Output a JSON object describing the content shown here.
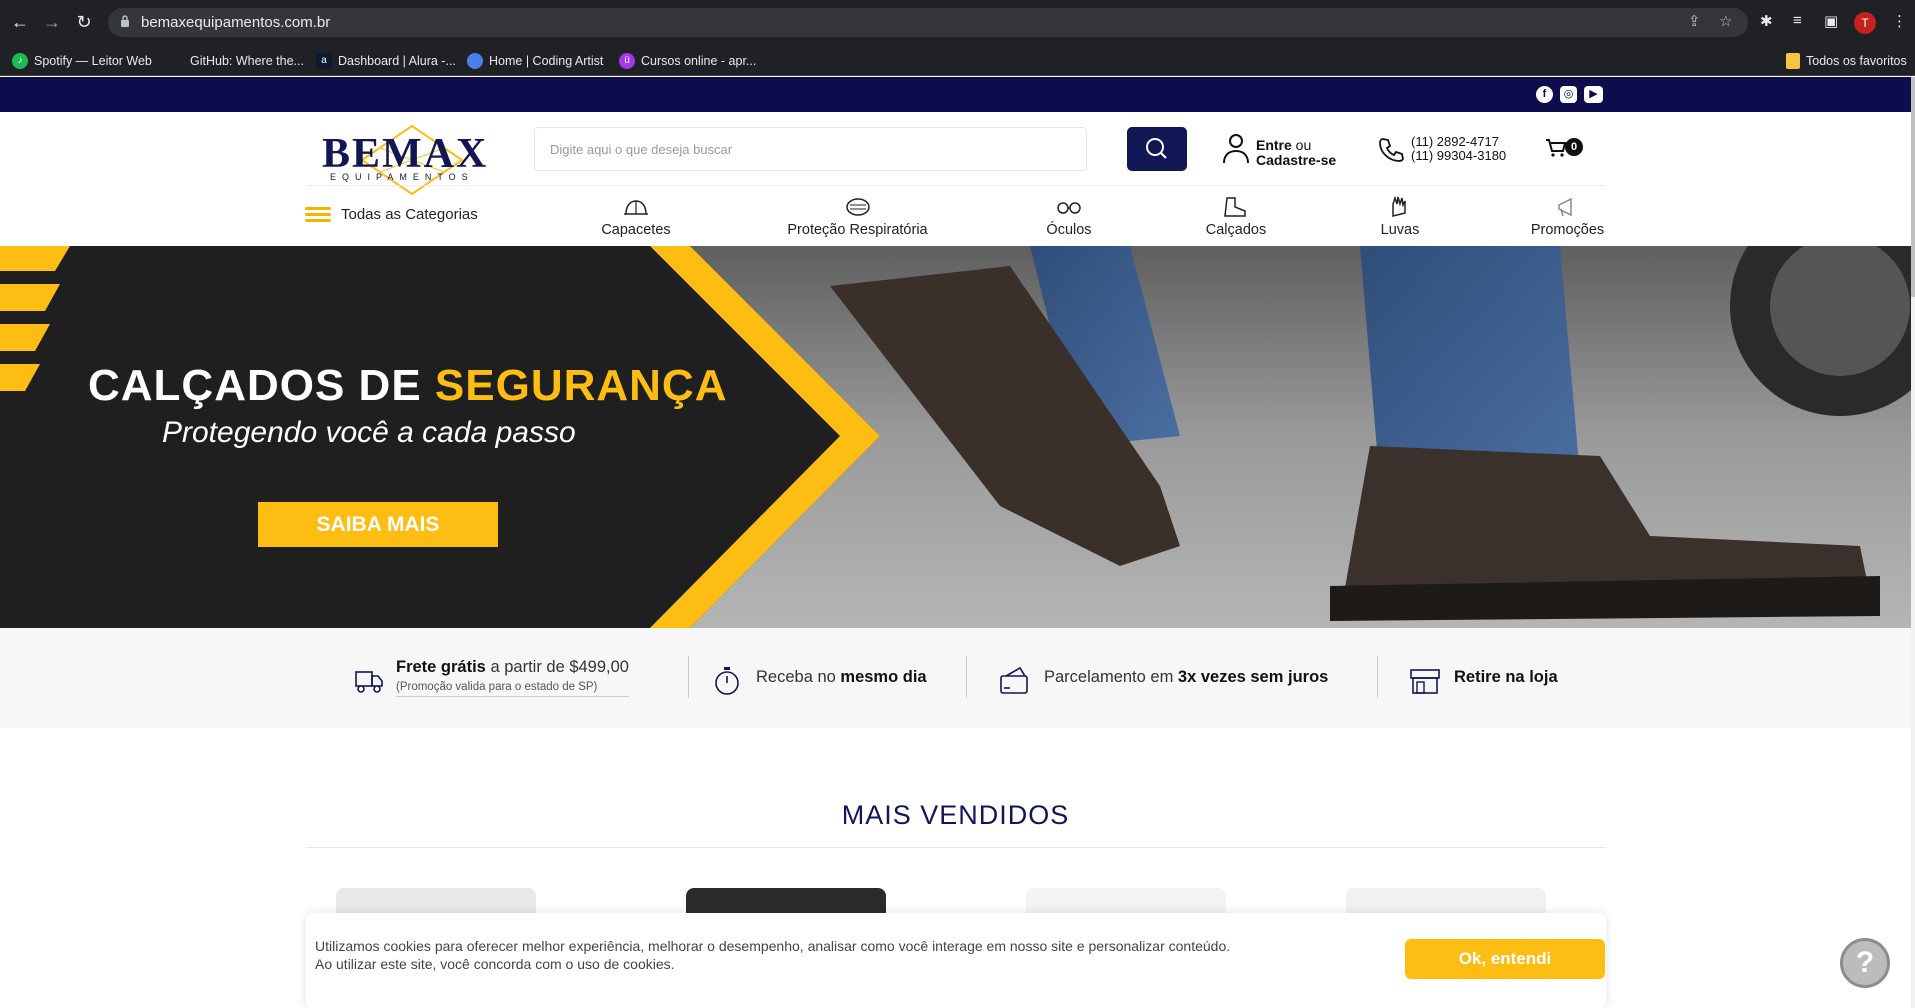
{
  "browser": {
    "url": "bemaxequipamentos.com.br",
    "bookmarks": [
      {
        "label": "Spotify — Leitor Web",
        "icon": "spotify-icon"
      },
      {
        "label": "GitHub: Where the...",
        "icon": "github-icon"
      },
      {
        "label": "Dashboard | Alura -...",
        "icon": "alura-icon"
      },
      {
        "label": "Home | Coding Artist",
        "icon": "codingartist-icon"
      },
      {
        "label": "Cursos online - apr...",
        "icon": "udemy-icon"
      }
    ],
    "all_favorites": "Todos os favoritos",
    "profile_initial": "T"
  },
  "header": {
    "logo_word": "BEMAX",
    "logo_sub": "EQUIPAMENTOS",
    "search_placeholder": "Digite aqui o que deseja buscar",
    "account_line1_bold": "Entre",
    "account_line1_rest": " ou",
    "account_line2": "Cadastre-se",
    "phone1": "(11) 2892-4717",
    "phone2": "(11) 99304-3180",
    "cart_count": "0",
    "all_categories": "Todas as Categorias",
    "categories": [
      {
        "label": "Capacetes",
        "icon": "helmet-icon"
      },
      {
        "label": "Proteção Respiratória",
        "icon": "mask-icon"
      },
      {
        "label": "Óculos",
        "icon": "glasses-icon"
      },
      {
        "label": "Calçados",
        "icon": "boot-icon"
      },
      {
        "label": "Luvas",
        "icon": "glove-icon"
      },
      {
        "label": "Promoções",
        "icon": "megaphone-icon"
      }
    ]
  },
  "banner": {
    "title_part1": "CALÇADOS DE ",
    "title_part2": "SEGURANÇA",
    "subtitle": "Protegendo você a cada passo",
    "button": "SAIBA MAIS"
  },
  "benefits": {
    "shipping_bold": "Frete grátis",
    "shipping_rest": " a partir de $499,00",
    "shipping_note": "(Promoção valida para o estado de SP)",
    "sameday_rest": "Receba no ",
    "sameday_bold": "mesmo dia",
    "installments_rest": "Parcelamento em ",
    "installments_bold": "3x vezes sem juros",
    "pickup_bold": "Retire na loja"
  },
  "section": {
    "title": "MAIS VENDIDOS"
  },
  "cookie": {
    "line1": "Utilizamos cookies para oferecer melhor experiência, melhorar o desempenho, analisar como você interage em nosso site e personalizar conteúdo.",
    "line2": "Ao utilizar este site, você concorda com o uso de cookies.",
    "ok_button": "Ok, entendi"
  },
  "help_symbol": "?",
  "colors": {
    "navy": "#111655",
    "accent_yellow": "#fdbd13",
    "top_strip": "#0d0d4d"
  }
}
